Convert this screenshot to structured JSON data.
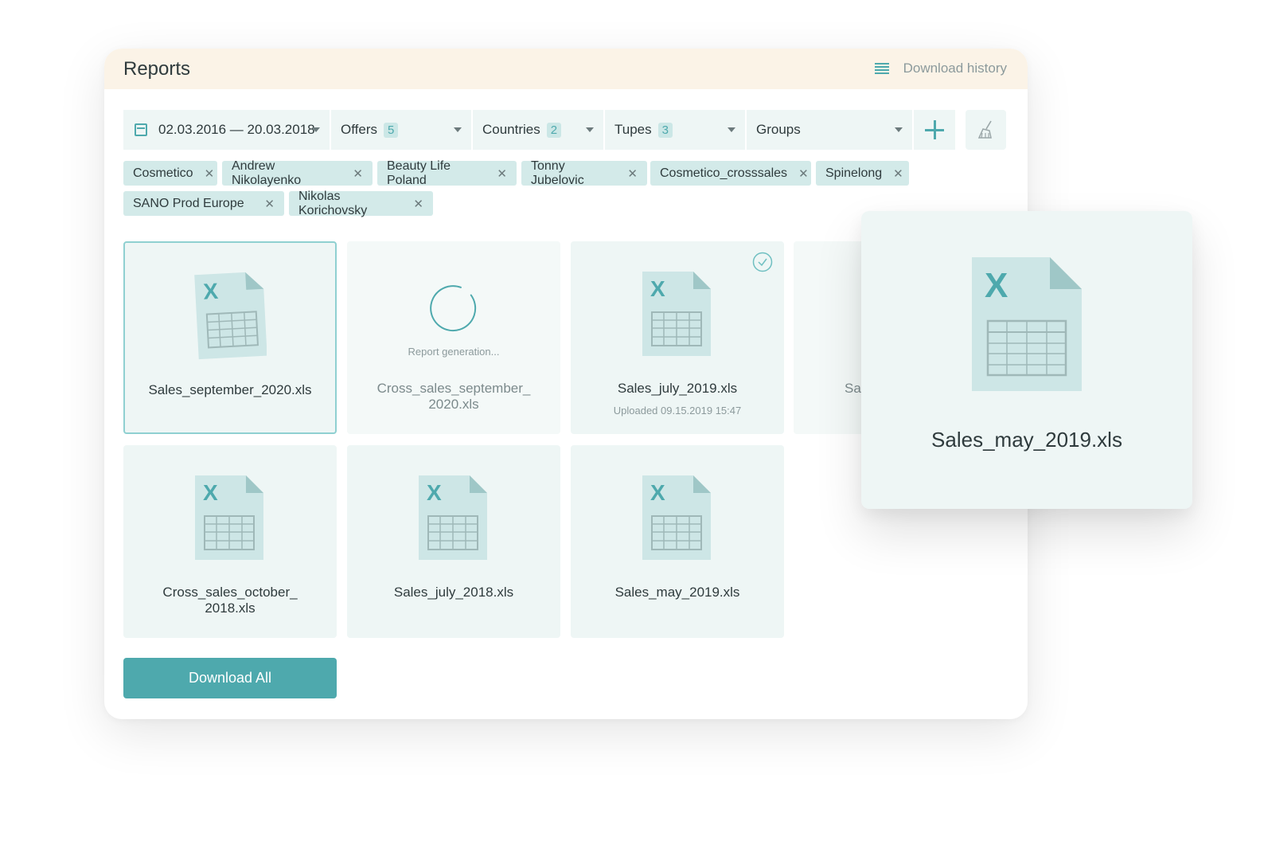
{
  "header": {
    "title": "Reports",
    "download_history_label": "Download history"
  },
  "filters": {
    "date_range": "02.03.2016 — 20.03.2018",
    "offers": {
      "label": "Offers",
      "count": "5"
    },
    "countries": {
      "label": "Countries",
      "count": "2"
    },
    "tupes": {
      "label": "Tupes",
      "count": "3"
    },
    "groups": {
      "label": "Groups"
    }
  },
  "tags": [
    "Cosmetico",
    "Andrew Nikolayenko",
    "Beauty Life Poland",
    "Tonny Jubelovic",
    "Cosmetico_crosssales",
    "Spinelong",
    "SANO Prod Europe",
    "Nikolas Korichovsky"
  ],
  "files": [
    {
      "name": "Sales_september_2020.xls"
    },
    {
      "name_line1": "Cross_sales_september_",
      "name_line2": "2020.xls",
      "status": "Report generation..."
    },
    {
      "name": "Sales_july_2019.xls",
      "uploaded": "Uploaded 09.15.2019 15:47"
    },
    {
      "name_partial": "Sal"
    },
    {
      "name_line1": "Cross_sales_october_",
      "name_line2": "2018.xls"
    },
    {
      "name": "Sales_july_2018.xls"
    },
    {
      "name": "Sales_may_2019.xls"
    }
  ],
  "preview": {
    "name": "Sales_may_2019.xls"
  },
  "actions": {
    "download_all": "Download All"
  },
  "colors": {
    "accent": "#4ea9ad",
    "card_bg": "#eef6f5",
    "header_bg": "#fbf3e7",
    "tag_bg": "#d3eae9"
  },
  "icons": [
    "calendar-icon",
    "caret-down-icon",
    "plus-icon",
    "broom-icon",
    "list-icon",
    "close-icon",
    "xls-file-icon",
    "spinner-icon",
    "check-circle-icon"
  ]
}
